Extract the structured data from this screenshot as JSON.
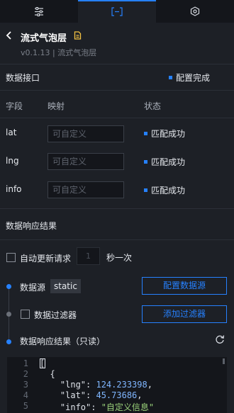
{
  "tabs": [
    {
      "name": "sliders-icon",
      "active": false
    },
    {
      "name": "data-icon",
      "active": true
    },
    {
      "name": "interaction-icon",
      "active": false
    }
  ],
  "header": {
    "title": "流式气泡层",
    "version": "v0.1.13 | 流式气泡层"
  },
  "data_interface": {
    "title": "数据接口",
    "status": "配置完成",
    "columns": {
      "field": "字段",
      "mapping": "映射",
      "status": "状态"
    },
    "rows": [
      {
        "field": "lat",
        "placeholder": "可自定义",
        "status": "匹配成功"
      },
      {
        "field": "lng",
        "placeholder": "可自定义",
        "status": "匹配成功"
      },
      {
        "field": "info",
        "placeholder": "可自定义",
        "status": "匹配成功"
      }
    ]
  },
  "response": {
    "title": "数据响应结果",
    "auto_update_label": "自动更新请求",
    "interval_value": "1",
    "interval_unit": "秒一次",
    "source_label": "数据源",
    "source_tag": "static",
    "configure_button": "配置数据源",
    "filter_label": "数据过滤器",
    "add_filter_button": "添加过滤器",
    "result_label": "数据响应结果（只读）"
  },
  "code": {
    "line_numbers": [
      "1",
      "2",
      "3",
      "4",
      "5"
    ],
    "line1": "[",
    "line2": "  {",
    "line3_key": "    \"lng\": ",
    "line3_val": "124.233398",
    "line3_tail": ",",
    "line4_key": "    \"lat\": ",
    "line4_val": "45.73686",
    "line4_tail": ",",
    "line5_key": "    \"info\": ",
    "line5_val": "\"自定义信息\""
  },
  "colors": {
    "accent": "#2681ff",
    "background": "#1d2026",
    "panel": "#14161b"
  }
}
